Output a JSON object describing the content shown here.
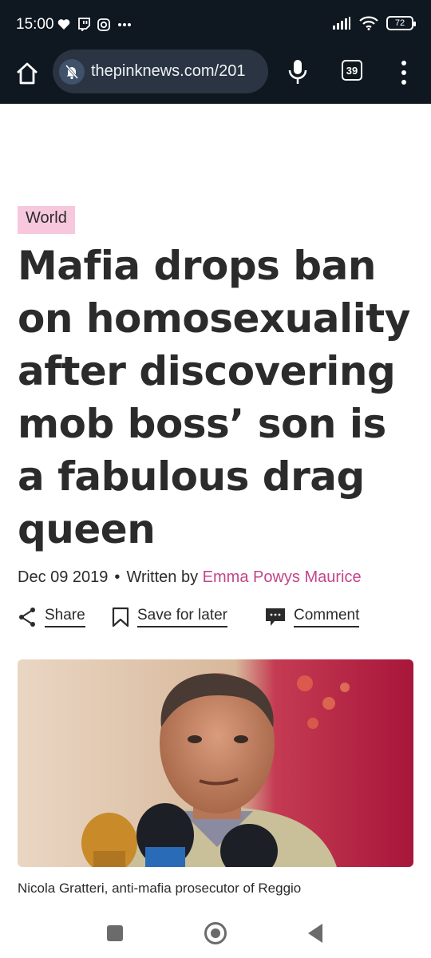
{
  "status_bar": {
    "time": "15:00",
    "battery": "72"
  },
  "browser": {
    "url": "thepinknews.com/201",
    "tab_count": "39"
  },
  "article": {
    "category": "World",
    "headline": "Mafia drops ban on homosexuality after discovering mob boss’ son is a fabulous drag queen",
    "date": "Dec 09 2019",
    "written_by_prefix": "Written by",
    "author": "Emma Powys Maurice",
    "actions": {
      "share": "Share",
      "save": "Save for later",
      "comment": "Comment"
    },
    "photo_caption": "Nicola Gratteri, anti-mafia prosecutor of Reggio"
  },
  "colors": {
    "top_bar_bg": "#0f1720",
    "category_bg": "#f7c8dd",
    "author_link": "#c4448b"
  }
}
